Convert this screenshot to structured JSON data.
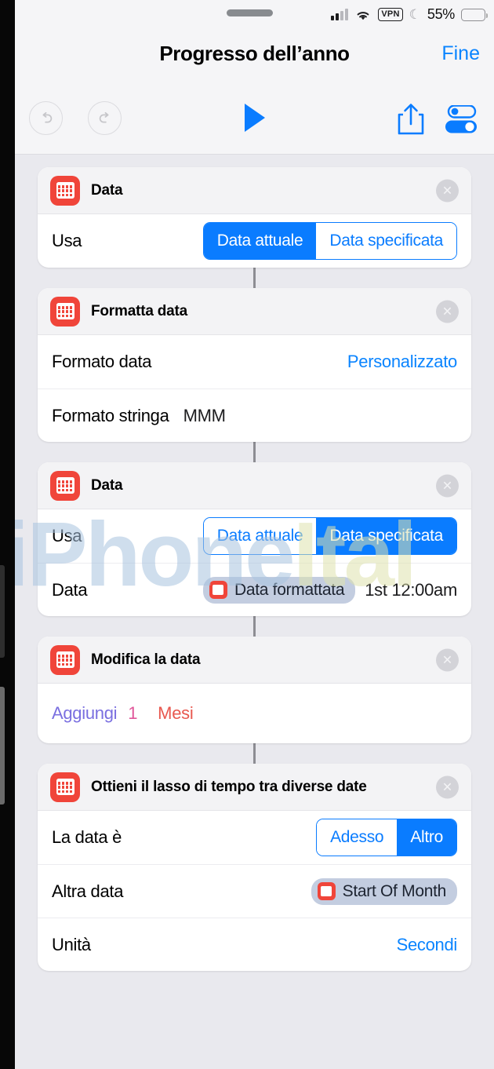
{
  "status_bar": {
    "grabber": "sheet-grabber",
    "signal": "cellular-signal",
    "wifi": "wifi-icon",
    "vpn_label": "VPN",
    "dnd": "crescent-moon-icon",
    "battery_percent": "55%",
    "battery_level": 55
  },
  "nav": {
    "title": "Progresso dell’anno",
    "done_label": "Fine"
  },
  "toolbar": {
    "undo": "undo-icon",
    "redo": "redo-icon",
    "play": "play-icon",
    "share": "share-icon",
    "settings": "settings-toggles-icon"
  },
  "watermark": {
    "part1": "iPhone",
    "part2": "Ital"
  },
  "cards": [
    {
      "title": "Data",
      "close": "×",
      "rows": [
        {
          "label": "Usa",
          "type": "segmented",
          "options": [
            "Data attuale",
            "Data specificata"
          ],
          "selected_index": 0
        }
      ]
    },
    {
      "title": "Formatta data",
      "close": "×",
      "rows": [
        {
          "label": "Formato data",
          "type": "value-blue",
          "value": "Personalizzato"
        },
        {
          "label": "Formato stringa",
          "type": "value-inline",
          "value": "MMM"
        }
      ]
    },
    {
      "title": "Data",
      "close": "×",
      "rows": [
        {
          "label": "Usa",
          "type": "segmented",
          "options": [
            "Data attuale",
            "Data specificata"
          ],
          "selected_index": 1
        },
        {
          "label": "Data",
          "type": "token",
          "token": "Data formattata",
          "value": "1st 12:00am"
        }
      ]
    },
    {
      "title": "Modifica la data",
      "close": "×",
      "rows": [
        {
          "type": "formula",
          "operation": "Aggiungi",
          "amount": "1",
          "unit": "Mesi"
        }
      ]
    },
    {
      "title": "Ottieni il lasso di tempo tra diverse date",
      "close": "×",
      "rows": [
        {
          "label": "La data è",
          "type": "segmented",
          "options": [
            "Adesso",
            "Altro"
          ],
          "selected_index": 1
        },
        {
          "label": "Altra data",
          "type": "token",
          "token": "Start Of Month"
        },
        {
          "label": "Unità",
          "type": "value-blue",
          "value": "Secondi"
        }
      ]
    }
  ],
  "colors": {
    "accent_blue": "#0a7cff",
    "app_red": "#f0453a",
    "token_bg": "#c3cde0",
    "formula_op": "#7a6fe0",
    "formula_num": "#e0569a",
    "formula_unit": "#e8584f"
  }
}
